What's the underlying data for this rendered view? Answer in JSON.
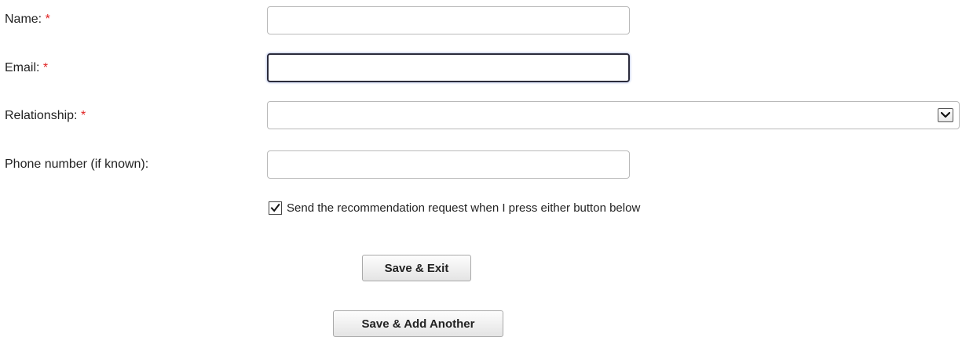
{
  "form": {
    "name": {
      "label": "Name:",
      "required_mark": "*",
      "value": ""
    },
    "email": {
      "label": "Email:",
      "required_mark": "*",
      "value": ""
    },
    "relationship": {
      "label": "Relationship:",
      "required_mark": "*",
      "selected": ""
    },
    "phone": {
      "label": "Phone number (if known):",
      "value": ""
    },
    "send_request": {
      "label": "Send the recommendation request when I press either button below",
      "checked": true
    },
    "buttons": {
      "save_exit": "Save & Exit",
      "save_add_another": "Save & Add Another"
    }
  },
  "colors": {
    "required": "#e02020",
    "focus_border": "#2b2b3b"
  },
  "icons": {
    "dropdown": "chevron-down-icon",
    "checkbox": "checkmark-icon"
  }
}
